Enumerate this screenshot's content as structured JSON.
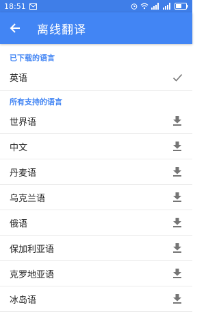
{
  "status_bar": {
    "time": "18:51",
    "colors": {
      "background": "#3f7ee8"
    }
  },
  "app_bar": {
    "title": "离线翻译",
    "color": "#4285f4"
  },
  "downloaded": {
    "header": "已下载的语言",
    "items": [
      {
        "label": "英语",
        "icon": "check-icon"
      }
    ]
  },
  "all": {
    "header": "所有支持的语言",
    "items": [
      {
        "label": "世界语",
        "icon": "download-icon"
      },
      {
        "label": "中文",
        "icon": "download-icon"
      },
      {
        "label": "丹麦语",
        "icon": "download-icon"
      },
      {
        "label": "乌克兰语",
        "icon": "download-icon"
      },
      {
        "label": "俄语",
        "icon": "download-icon"
      },
      {
        "label": "保加利亚语",
        "icon": "download-icon"
      },
      {
        "label": "克罗地亚语",
        "icon": "download-icon"
      },
      {
        "label": "冰岛语",
        "icon": "download-icon"
      }
    ]
  }
}
